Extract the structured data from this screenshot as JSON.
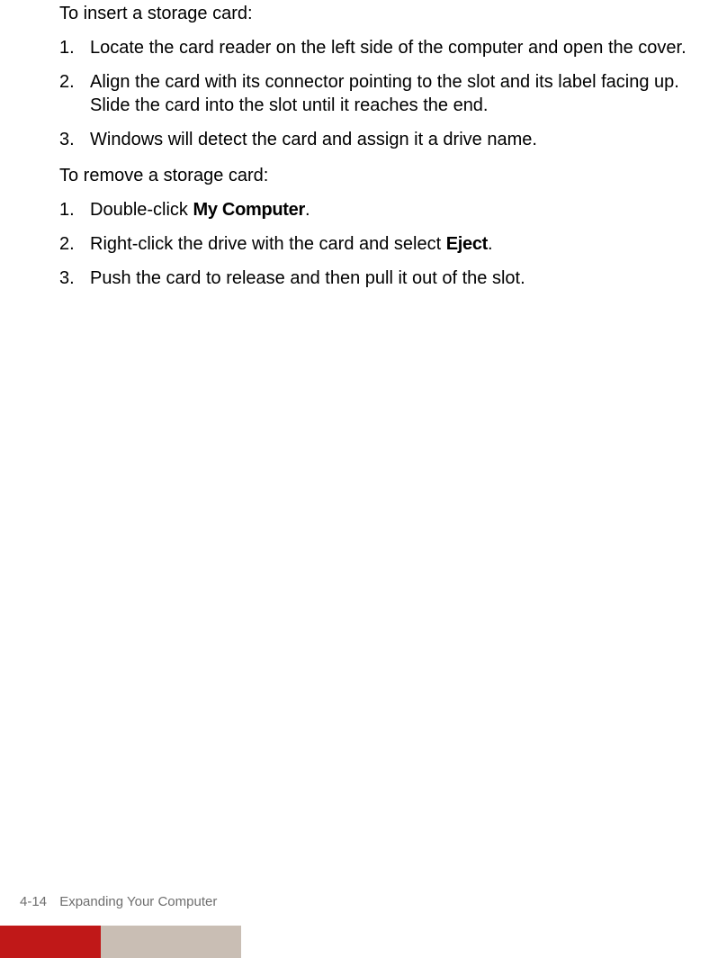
{
  "insert": {
    "intro": "To insert a storage card:",
    "steps": [
      "Locate the card reader on the left side of the computer and open the cover.",
      "Align the card with its connector pointing to the slot and its label facing up. Slide the card into the slot until it reaches the end.",
      "Windows will detect the card and assign it a drive name."
    ]
  },
  "remove": {
    "intro": "To remove a storage card:",
    "steps": {
      "s1_pre": "Double-click ",
      "s1_bold": "My Computer",
      "s1_post": ".",
      "s2_pre": "Right-click the drive with the card and select ",
      "s2_bold": "Eject",
      "s2_post": ".",
      "s3": "Push the card to release and then pull it out of the slot."
    }
  },
  "footer": {
    "page_number": "4-14",
    "section": "Expanding Your Computer"
  },
  "numbers": {
    "n1": "1.",
    "n2": "2.",
    "n3": "3."
  }
}
